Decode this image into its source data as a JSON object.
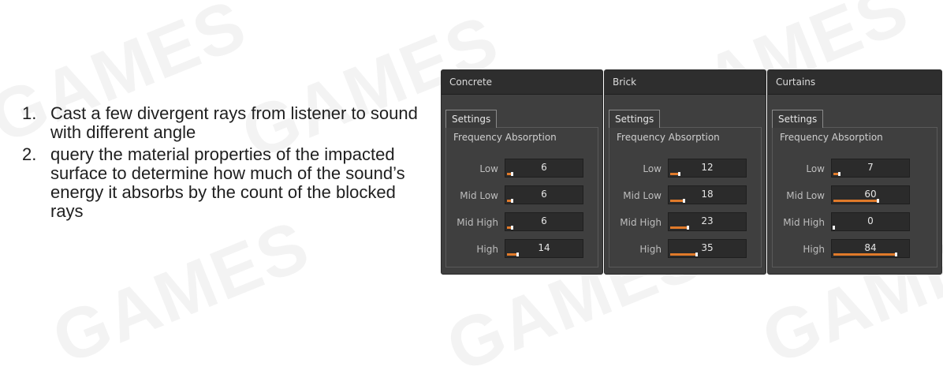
{
  "bullets": [
    {
      "num": "1.",
      "text": "Cast a few divergent rays from listener to sound with different angle"
    },
    {
      "num": "2.",
      "text": "query the material properties of the impacted surface to determine how much of the sound’s energy it absorbs by the count of the blocked rays"
    }
  ],
  "panels": [
    {
      "title": "Concrete",
      "tab": "Settings",
      "group": "Frequency Absorption",
      "rows": [
        {
          "label": "Low",
          "value": "6",
          "level": 6
        },
        {
          "label": "Mid Low",
          "value": "6",
          "level": 6
        },
        {
          "label": "Mid High",
          "value": "6",
          "level": 6
        },
        {
          "label": "High",
          "value": "14",
          "level": 14
        }
      ]
    },
    {
      "title": "Brick",
      "tab": "Settings",
      "group": "Frequency Absorption",
      "rows": [
        {
          "label": "Low",
          "value": "12",
          "level": 12
        },
        {
          "label": "Mid Low",
          "value": "18",
          "level": 18
        },
        {
          "label": "Mid High",
          "value": "23",
          "level": 23
        },
        {
          "label": "High",
          "value": "35",
          "level": 35
        }
      ]
    },
    {
      "title": "Curtains",
      "tab": "Settings",
      "group": "Frequency Absorption",
      "rows": [
        {
          "label": "Low",
          "value": "7",
          "level": 7
        },
        {
          "label": "Mid Low",
          "value": "60",
          "level": 60
        },
        {
          "label": "Mid High",
          "value": "0",
          "level": 0
        },
        {
          "label": "High",
          "value": "84",
          "level": 84
        }
      ]
    }
  ],
  "colors": {
    "accent": "#e07a2a",
    "panel_bg": "#3f3f3f",
    "field_bg": "#2b2b2b"
  }
}
